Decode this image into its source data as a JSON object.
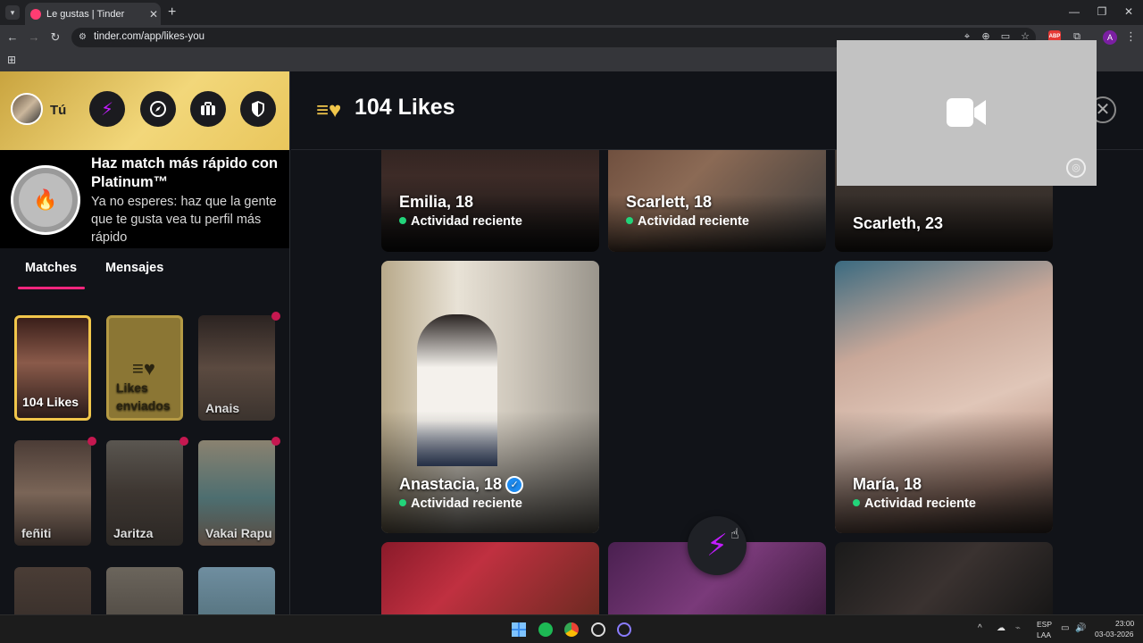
{
  "browser": {
    "tab_title": "Le gustas | Tinder",
    "url": "tinder.com/app/likes-you",
    "new_tab_symbol": "+",
    "close_tab_symbol": "✕",
    "profile_letter": "A",
    "extension_abp": "ABP"
  },
  "sidebar": {
    "user_label": "Tú",
    "nav_icons": [
      "boost-icon",
      "explore-icon",
      "briefcase-icon",
      "shield-icon"
    ],
    "promo": {
      "title": "Haz match más rápido con Platinum™",
      "text": "Ya no esperes: haz que la gente que te gusta vea tu perfil más rápido"
    },
    "tabs": [
      {
        "label": "Matches",
        "active": true
      },
      {
        "label": "Mensajes",
        "active": false
      }
    ],
    "matches": [
      {
        "name": "104 Likes",
        "type": "likes"
      },
      {
        "name": "Likes enviados",
        "type": "sent"
      },
      {
        "name": "Anais",
        "unread": true
      },
      {
        "name": "feñiti",
        "unread": true
      },
      {
        "name": "Jaritza",
        "unread": true
      },
      {
        "name": "Vakai Rapu",
        "unread": true
      }
    ]
  },
  "main": {
    "title": "104 Likes",
    "cards": [
      {
        "name": "Emilia, 18",
        "status": "Actividad reciente"
      },
      {
        "name": "Scarlett, 18",
        "status": "Actividad reciente"
      },
      {
        "name": "Scarleth, 23",
        "status": ""
      },
      {
        "name": "Anastacia, 18",
        "status": "Actividad reciente",
        "verified": true
      },
      {
        "name": "María, 18",
        "status": "Actividad reciente"
      }
    ]
  },
  "taskbar": {
    "lang_top": "ESP",
    "lang_bottom": "LAA",
    "time": "23:00",
    "date": "03-03-2026"
  },
  "colors": {
    "tinder_pink": "#fd267d",
    "gold": "#f1c64b",
    "boost_purple": "#c21cff",
    "online_green": "#22d47a",
    "verified_blue": "#1d8bf1"
  }
}
